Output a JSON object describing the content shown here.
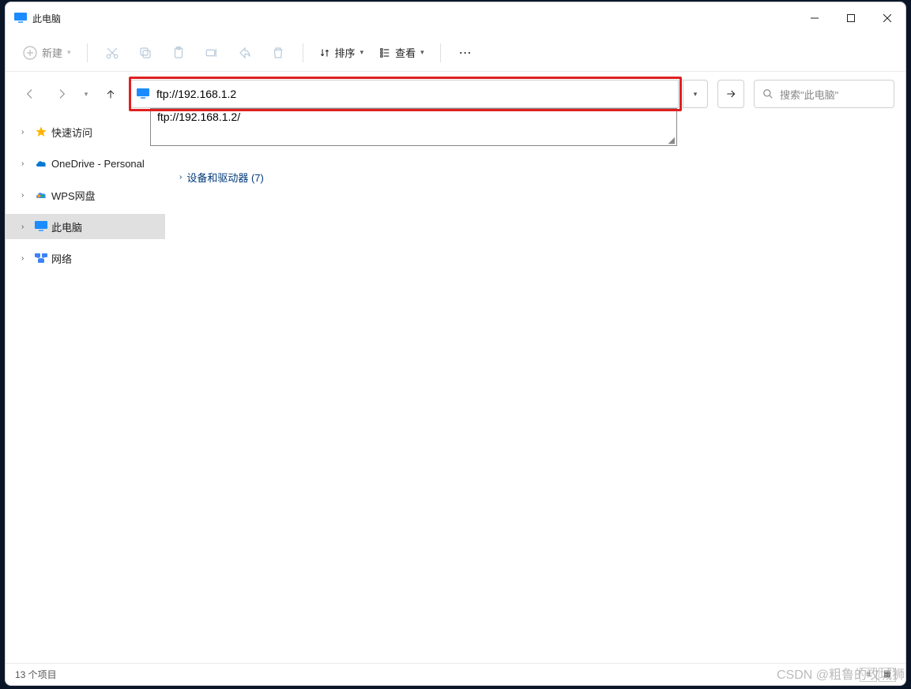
{
  "window": {
    "title": "此电脑"
  },
  "toolbar": {
    "new_label": "新建",
    "sort_label": "排序",
    "view_label": "查看"
  },
  "address": {
    "value": "ftp://192.168.1.2",
    "dropdown_suggestion": "ftp://192.168.1.2/"
  },
  "search": {
    "placeholder": "搜索\"此电脑\""
  },
  "sidebar": {
    "items": [
      {
        "label": "快速访问",
        "icon": "star"
      },
      {
        "label": "OneDrive - Personal",
        "icon": "cloud-blue"
      },
      {
        "label": "WPS网盘",
        "icon": "cloud-multi"
      },
      {
        "label": "此电脑",
        "icon": "monitor",
        "selected": true
      },
      {
        "label": "网络",
        "icon": "network"
      }
    ]
  },
  "content": {
    "devices_group": "设备和驱动器 (7)"
  },
  "statusbar": {
    "item_count": "13 个项目"
  },
  "watermark": "CSDN @粗鲁的攻城狮"
}
